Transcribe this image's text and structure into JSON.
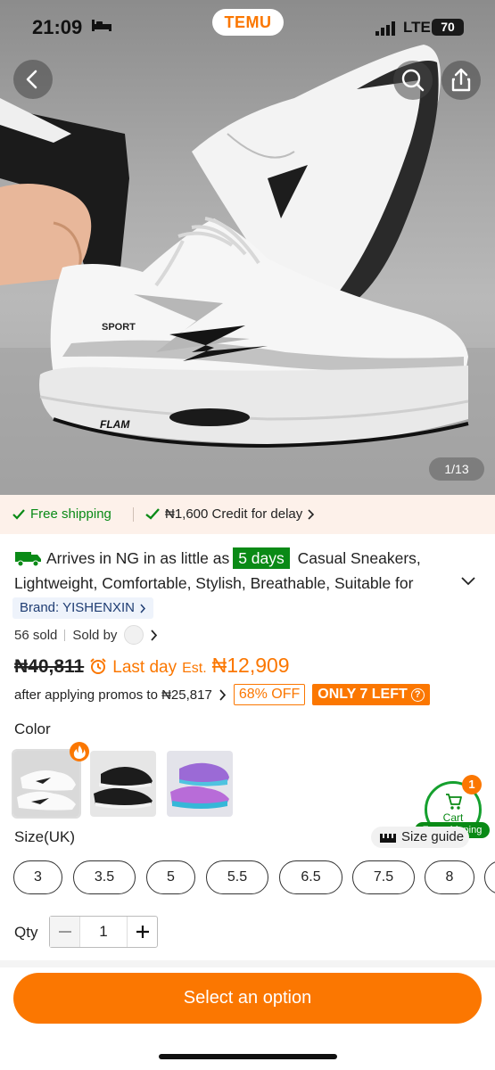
{
  "status_bar": {
    "time": "21:09",
    "app_name": "TEMU",
    "network": "LTE",
    "battery": "70"
  },
  "gallery": {
    "counter": "1/13"
  },
  "shipping_bar": {
    "free_shipping": "Free shipping",
    "credit": "₦1,600 Credit for delay"
  },
  "product": {
    "arrives_text": "Arrives in NG in as little as",
    "days_badge": "5 days",
    "title_line1": "Casual Sneakers,",
    "title_line2": "Lightweight, Comfortable, Stylish, Breathable, Suitable for",
    "brand": "Brand: YISHENXIN",
    "sold": "56 sold",
    "sold_by": "Sold by"
  },
  "pricing": {
    "old_price": "₦40,811",
    "last_day": "Last day",
    "est": "Est.",
    "new_price": "₦12,909",
    "promo_text": "after applying promos to ₦25,817",
    "off_badge": "68% OFF",
    "stock_badge": "ONLY 7 LEFT"
  },
  "color": {
    "label": "Color",
    "swatches": [
      "white",
      "black",
      "purple"
    ]
  },
  "cart": {
    "label": "Cart",
    "count": "1",
    "free_shipping": "Free shipping"
  },
  "size": {
    "label": "Size(UK)",
    "guide": "Size guide",
    "options": [
      "3",
      "3.5",
      "5",
      "5.5",
      "6.5",
      "7.5",
      "8"
    ]
  },
  "qty": {
    "label": "Qty",
    "value": "1"
  },
  "cta": {
    "label": "Select an option"
  },
  "colors": {
    "accent": "#fb7701",
    "green": "#0a8a16",
    "ship_bg": "#fdf1ea"
  }
}
